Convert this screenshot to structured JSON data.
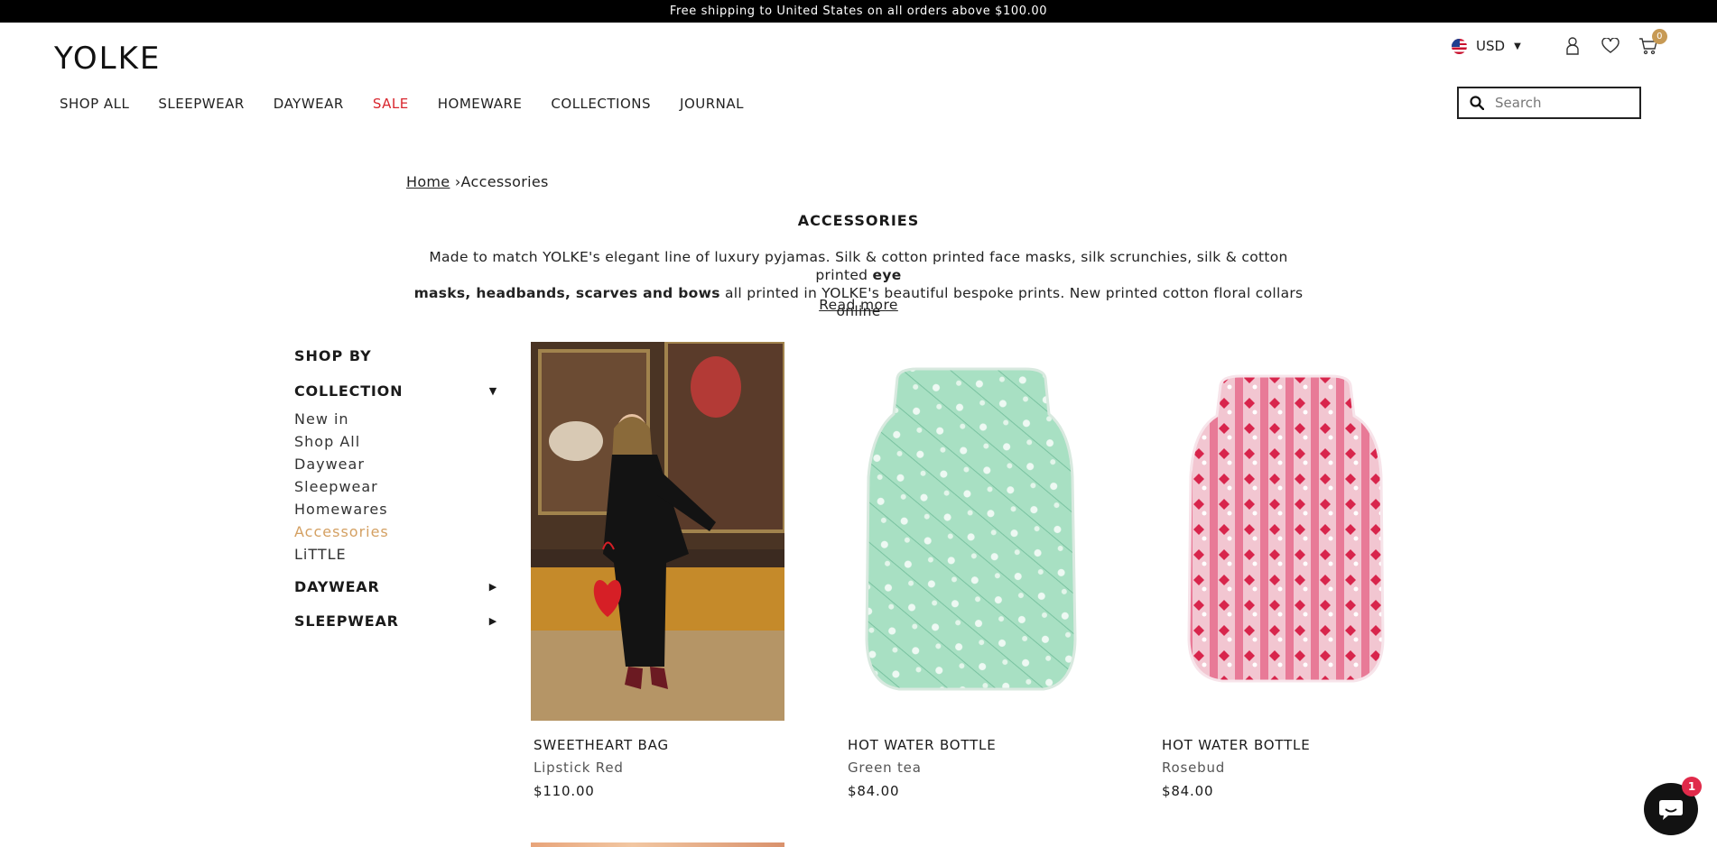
{
  "announcement": "Free shipping to United States on all orders above $100.00",
  "brand": "YOLKE",
  "header": {
    "currency": "USD",
    "cart_count": "0",
    "search_placeholder": "Search"
  },
  "nav": [
    {
      "label": "SHOP ALL"
    },
    {
      "label": "SLEEPWEAR"
    },
    {
      "label": "DAYWEAR"
    },
    {
      "label": "SALE",
      "highlight": true
    },
    {
      "label": "HOMEWARE"
    },
    {
      "label": "COLLECTIONS"
    },
    {
      "label": "JOURNAL"
    }
  ],
  "breadcrumb": {
    "home": "Home",
    "separator": "›",
    "current": "Accessories"
  },
  "page": {
    "title": "ACCESSORIES",
    "desc_part1": "Made to match YOLKE's elegant line of luxury pyjamas. Silk & cotton printed face masks, silk scrunchies, silk & cotton printed ",
    "desc_bold1": "eye",
    "desc_bold2": "masks, headbands, scarves and bows",
    "desc_part2": " all printed in YOLKE's beautiful bespoke prints. New printed cotton floral collars online",
    "read_more": "Read more"
  },
  "sidebar": {
    "title": "SHOP BY",
    "groups": [
      {
        "label": "COLLECTION",
        "arrow": "▼",
        "items": [
          "New in",
          "Shop All",
          "Daywear",
          "Sleepwear",
          "Homewares",
          "Accessories",
          "LiTTLE"
        ],
        "active_index": 5
      },
      {
        "label": "DAYWEAR",
        "arrow": "▶"
      },
      {
        "label": "SLEEPWEAR",
        "arrow": "▶"
      }
    ]
  },
  "products": [
    {
      "name": "SWEETHEART BAG",
      "variant": "Lipstick Red",
      "price": "$110.00"
    },
    {
      "name": "HOT WATER BOTTLE",
      "variant": "Green tea",
      "price": "$84.00"
    },
    {
      "name": "HOT WATER BOTTLE",
      "variant": "Rosebud",
      "price": "$84.00"
    }
  ],
  "chat": {
    "badge": "1"
  },
  "colors": {
    "sale": "#d8262e",
    "active_filter": "#d4a062",
    "cart_badge": "#c79a55",
    "chat_badge": "#e02a4a"
  }
}
